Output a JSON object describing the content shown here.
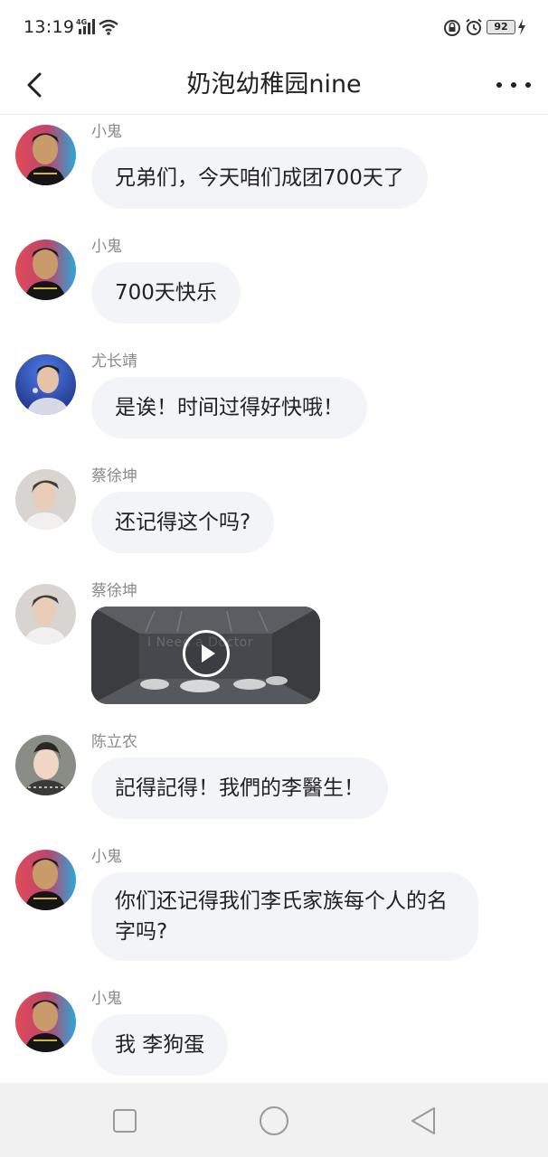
{
  "status_bar": {
    "time": "13:19",
    "network": "4G",
    "battery": "92"
  },
  "header": {
    "title": "奶泡幼稚园nine"
  },
  "messages": [
    {
      "sender": "小鬼",
      "text": "兄弟们，今天咱们成团700天了",
      "avatar": "avatar-xiaogui"
    },
    {
      "sender": "小鬼",
      "text": "700天快乐",
      "avatar": "avatar-xiaogui"
    },
    {
      "sender": "尤长靖",
      "text": "是诶！时间过得好快哦！",
      "avatar": "avatar-youzhangjing"
    },
    {
      "sender": "蔡徐坤",
      "text": "还记得这个吗?",
      "avatar": "avatar-caixukun"
    },
    {
      "sender": "蔡徐坤",
      "video_caption": "I  Need  a  Doctor",
      "avatar": "avatar-caixukun"
    },
    {
      "sender": "陈立农",
      "text": "記得記得！我們的李醫生！",
      "avatar": "avatar-chenlinong"
    },
    {
      "sender": "小鬼",
      "text": "你们还记得我们李氏家族每个人的名字吗?",
      "avatar": "avatar-xiaogui"
    },
    {
      "sender": "小鬼",
      "text": "我 李狗蛋",
      "avatar": "avatar-xiaogui"
    }
  ],
  "colors": {
    "bubble_bg": "#f3f4f8",
    "sender_text": "#8a8a8a",
    "navbar_bg": "#f1f1f1"
  },
  "icons": {
    "back": "chevron-left-icon",
    "more": "more-dots-icon",
    "play": "play-icon",
    "nav_recent": "square-icon",
    "nav_home": "circle-icon",
    "nav_back": "triangle-back-icon"
  }
}
